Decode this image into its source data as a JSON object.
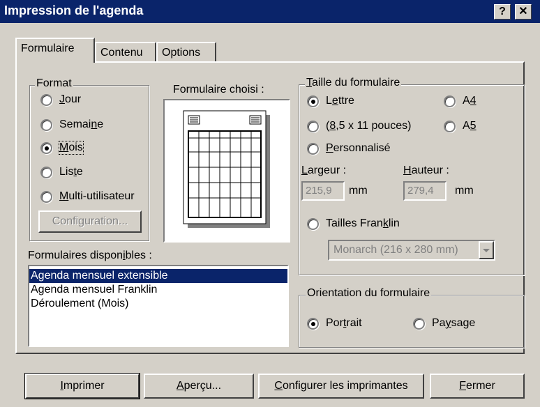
{
  "window": {
    "title": "Impression de l'agenda",
    "help_btn": "?",
    "close_btn": "✕"
  },
  "tabs": [
    {
      "label": "Formulaire"
    },
    {
      "label": "Contenu"
    },
    {
      "label": "Options"
    }
  ],
  "format": {
    "legend": "Format",
    "options": [
      {
        "label": "Jour",
        "accel": "J",
        "rest": "our"
      },
      {
        "label": "Semaine",
        "pre": "Semai",
        "accel": "n",
        "rest": "e"
      },
      {
        "label": "Mois",
        "pre": "",
        "accel": "M",
        "rest": "ois"
      },
      {
        "label": "Liste",
        "pre": "Lis",
        "accel": "t",
        "rest": "e"
      },
      {
        "label": "Multi-utilisateur",
        "pre": "",
        "accel": "M",
        "rest": "ulti-utilisateur"
      }
    ],
    "selected": "Mois",
    "config_button": "Configuration..."
  },
  "preview": {
    "label": "Formulaire choisi :"
  },
  "available": {
    "label_pre": "Formulaires dispon",
    "label_accel": "i",
    "label_rest": "bles :",
    "items": [
      "Agenda mensuel extensible",
      "Agenda mensuel Franklin",
      "Déroulement (Mois)"
    ],
    "selected": "Agenda mensuel extensible"
  },
  "size": {
    "legend_pre": "",
    "legend_accel": "T",
    "legend_rest": "aille du formulaire",
    "lettre": {
      "pre": "L",
      "accel": "e",
      "rest": "ttre"
    },
    "a4": {
      "pre": "A",
      "accel": "4",
      "rest": ""
    },
    "usletter": {
      "pre": "(",
      "accel": "8",
      "rest": ",5 x 11 pouces)"
    },
    "a5": {
      "pre": "A",
      "accel": "5",
      "rest": ""
    },
    "custom": {
      "pre": "",
      "accel": "P",
      "rest": "ersonnalisé"
    },
    "selected": "Lettre",
    "width_label": {
      "pre": "",
      "accel": "L",
      "rest": "argeur :"
    },
    "height_label": {
      "pre": "",
      "accel": "H",
      "rest": "auteur :"
    },
    "width_value": "215,9",
    "height_value": "279,4",
    "unit": "mm",
    "franklin": {
      "pre": "Tailles Fran",
      "accel": "k",
      "rest": "lin"
    },
    "franklin_select": "Monarch  (216 x 280 mm)"
  },
  "orientation": {
    "legend": "Orientation du formulaire",
    "portrait": {
      "pre": "Por",
      "accel": "t",
      "rest": "rait"
    },
    "landscape": {
      "pre": "Pa",
      "accel": "y",
      "rest": "sage"
    },
    "selected": "Portrait"
  },
  "buttons": {
    "print": {
      "pre": "",
      "accel": "I",
      "rest": "mprimer"
    },
    "preview": {
      "pre": "",
      "accel": "A",
      "rest": "perçu..."
    },
    "setup": {
      "pre": "",
      "accel": "C",
      "rest": "onfigurer les imprimantes"
    },
    "close": {
      "pre": "",
      "accel": "F",
      "rest": "ermer"
    }
  }
}
